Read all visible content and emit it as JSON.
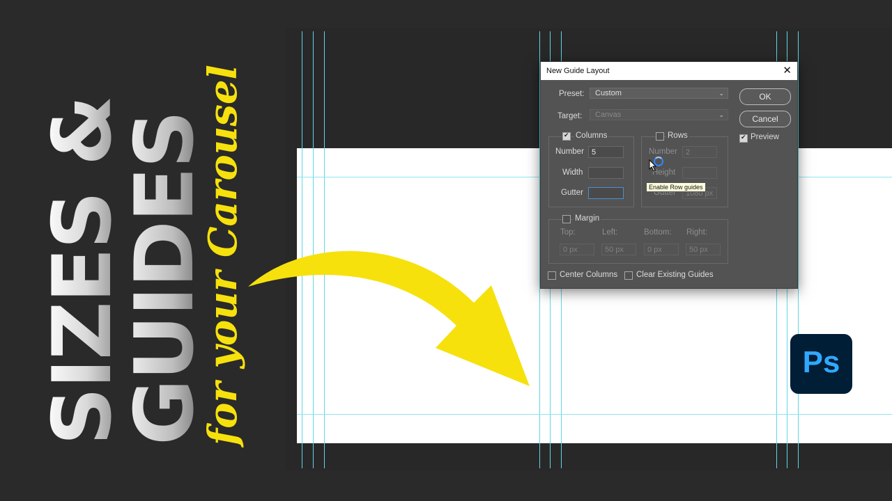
{
  "thumbnail": {
    "title_line1": "SIZES &",
    "title_line2": "GUIDES",
    "subtitle": "for your Carousel",
    "accent_color": "#f6e10d",
    "guide_color": "#5fd7e6"
  },
  "dialog": {
    "title": "New Guide Layout",
    "close_icon": "close-icon",
    "preset_label": "Preset:",
    "preset_value": "Custom",
    "target_label": "Target:",
    "target_value": "Canvas",
    "ok_label": "OK",
    "cancel_label": "Cancel",
    "preview_label": "Preview",
    "preview_checked": true,
    "columns": {
      "label": "Columns",
      "checked": true,
      "number_label": "Number",
      "number_value": "5",
      "width_label": "Width",
      "width_value": "",
      "gutter_label": "Gutter",
      "gutter_value": ""
    },
    "rows": {
      "label": "Rows",
      "checked": false,
      "number_label": "Number",
      "number_value": "2",
      "height_label": "Height",
      "height_value": "",
      "gutter_label": "Gutter",
      "gutter_value": "1080 px"
    },
    "tooltip": "Enable Row guides",
    "margin": {
      "label": "Margin",
      "checked": false,
      "top_label": "Top:",
      "left_label": "Left:",
      "bottom_label": "Bottom:",
      "right_label": "Right:",
      "top_value": "0 px",
      "left_value": "50 px",
      "bottom_value": "0 px",
      "right_value": "50 px"
    },
    "center_columns_label": "Center Columns",
    "clear_guides_label": "Clear Existing Guides"
  },
  "app_logo": {
    "text": "Ps",
    "bg_color": "#001e36",
    "text_color": "#31a8ff"
  }
}
